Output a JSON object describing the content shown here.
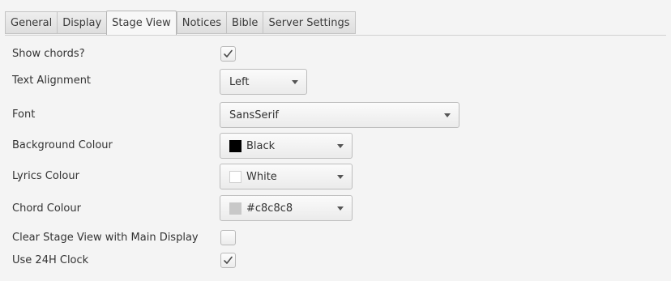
{
  "tabs": [
    {
      "label": "General",
      "active": false
    },
    {
      "label": "Display",
      "active": false
    },
    {
      "label": "Stage View",
      "active": true
    },
    {
      "label": "Notices",
      "active": false
    },
    {
      "label": "Bible",
      "active": false
    },
    {
      "label": "Server Settings",
      "active": false
    }
  ],
  "settings": {
    "show_chords": {
      "label": "Show chords?",
      "checked": true
    },
    "text_alignment": {
      "label": "Text Alignment",
      "value": "Left"
    },
    "font": {
      "label": "Font",
      "value": "SansSerif"
    },
    "background_colour": {
      "label": "Background Colour",
      "value": "Black",
      "swatch": "#000000"
    },
    "lyrics_colour": {
      "label": "Lyrics Colour",
      "value": "White",
      "swatch": "#ffffff"
    },
    "chord_colour": {
      "label": "Chord Colour",
      "value": "#c8c8c8",
      "swatch": "#c8c8c8"
    },
    "clear_stage_view": {
      "label": "Clear Stage View with Main Display",
      "checked": false
    },
    "use_24h_clock": {
      "label": "Use 24H Clock",
      "checked": true
    }
  },
  "icons": {
    "check": "check-icon",
    "dropdown": "chevron-down-icon"
  },
  "colors": {
    "active_tab_bg": "#f7f7f7",
    "tab_bg": "#e4e4e4",
    "panel_bg": "#f4f4f4",
    "text": "#333333"
  }
}
